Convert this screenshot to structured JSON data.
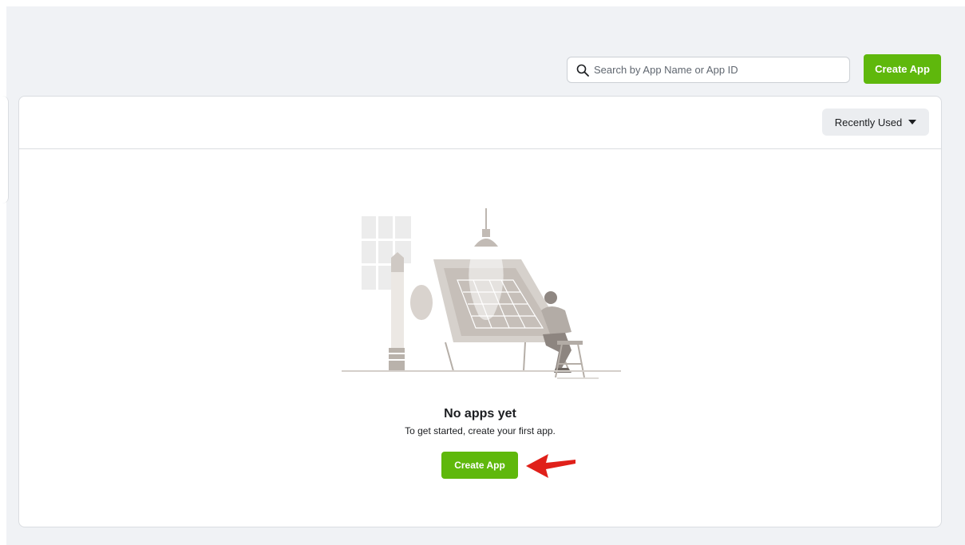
{
  "search": {
    "placeholder": "Search by App Name or App ID",
    "value": ""
  },
  "header": {
    "create_label": "Create App"
  },
  "sort": {
    "label": "Recently Used"
  },
  "empty_state": {
    "title": "No apps yet",
    "subtitle": "To get started, create your first app.",
    "create_label": "Create App"
  },
  "colors": {
    "accent": "#5fb80c",
    "background": "#f0f2f5",
    "arrow": "#e0201a"
  },
  "icons": {
    "search": "search-icon",
    "sort": "caret-down-icon",
    "arrow": "red-arrow-icon"
  }
}
